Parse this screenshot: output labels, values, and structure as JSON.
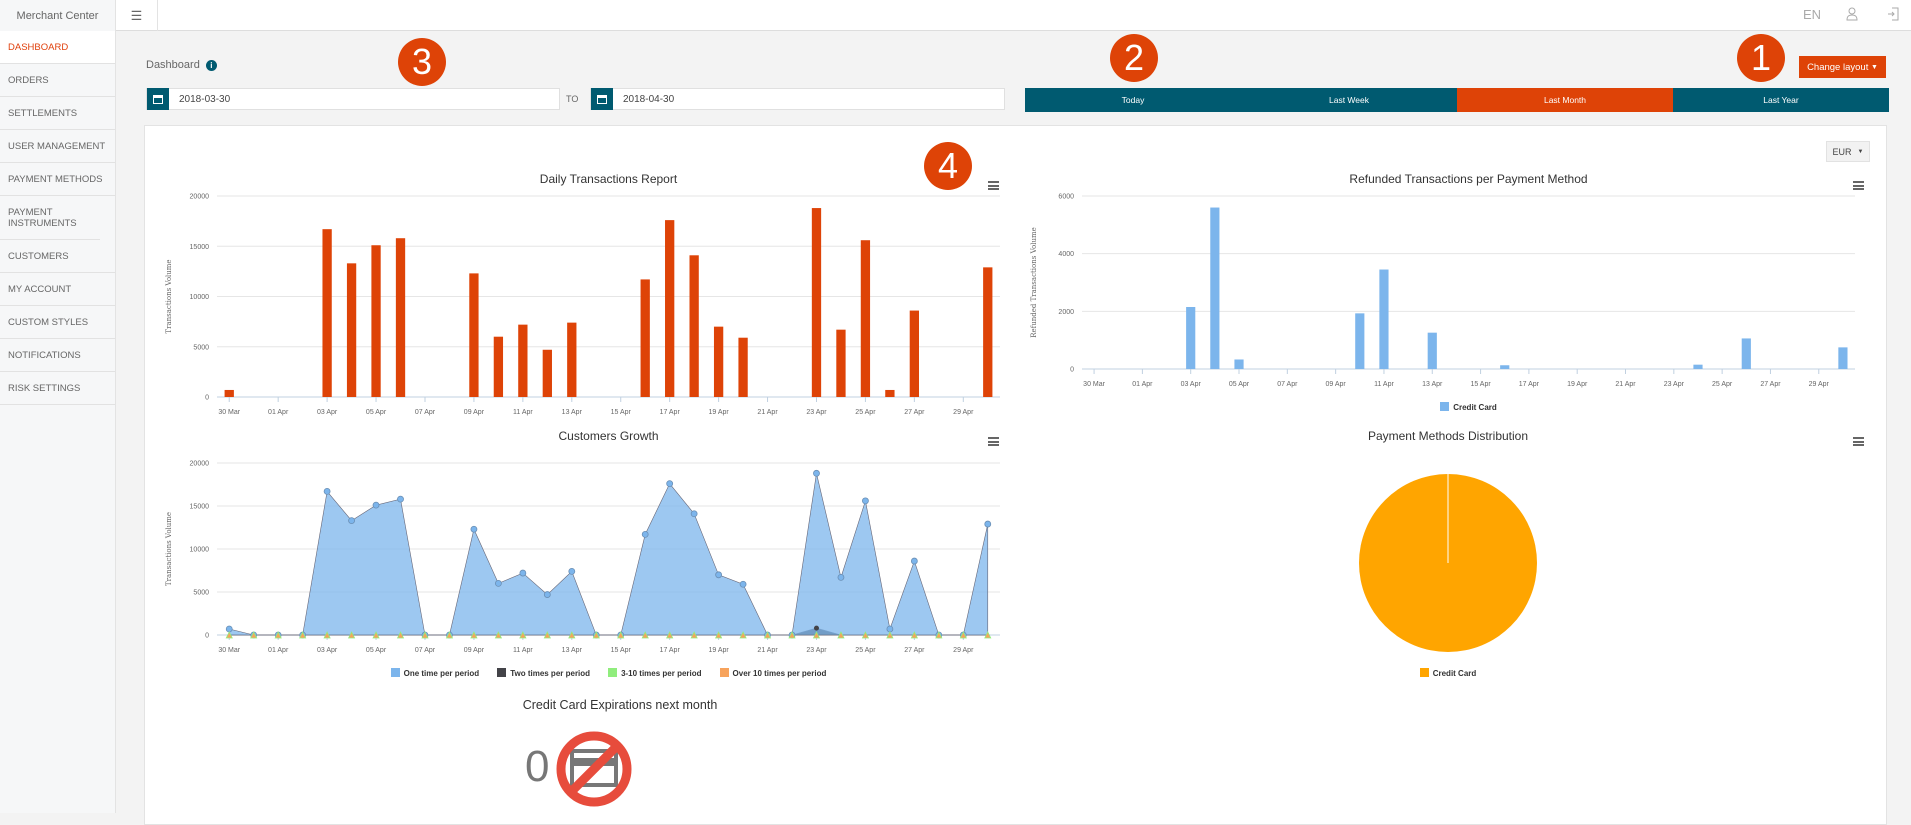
{
  "brand": "Merchant Center",
  "topbar": {
    "language": "EN",
    "icons": [
      "menu-icon",
      "user-icon",
      "logout-icon"
    ]
  },
  "sidebar": {
    "items": [
      {
        "label": "DASHBOARD",
        "active": true
      },
      {
        "label": "ORDERS"
      },
      {
        "label": "SETTLEMENTS"
      },
      {
        "label": "USER MANAGEMENT"
      },
      {
        "label": "PAYMENT METHODS"
      },
      {
        "label": "PAYMENT INSTRUMENTS"
      },
      {
        "label": "CUSTOMERS"
      },
      {
        "label": "MY ACCOUNT"
      },
      {
        "label": "CUSTOM STYLES"
      },
      {
        "label": "NOTIFICATIONS"
      },
      {
        "label": "RISK SETTINGS"
      }
    ]
  },
  "header": {
    "title": "Dashboard",
    "info_icon": "i",
    "date_from": "2018-03-30",
    "to_label": "TO",
    "date_to": "2018-04-30",
    "periods": [
      "Today",
      "Last Week",
      "Last Month",
      "Last Year"
    ],
    "selected_period": "Last Month",
    "change_layout": "Change layout"
  },
  "annotations": [
    "1",
    "2",
    "3",
    "4"
  ],
  "currency": "EUR",
  "colors": {
    "accent": "#de4307",
    "primary": "#005a70",
    "blue": "#7cb5ec",
    "pie": "#ffa500"
  },
  "chart_data": [
    {
      "id": "daily",
      "type": "bar",
      "title": "Daily Transactions Report",
      "ylabel": "Transactions Volume",
      "ylim": [
        0,
        20000
      ],
      "yticks": [
        0,
        5000,
        10000,
        15000,
        20000
      ],
      "grid": true,
      "categories": [
        "30 Mar",
        "31 Mar",
        "01 Apr",
        "02 Apr",
        "03 Apr",
        "04 Apr",
        "05 Apr",
        "06 Apr",
        "07 Apr",
        "08 Apr",
        "09 Apr",
        "10 Apr",
        "11 Apr",
        "12 Apr",
        "13 Apr",
        "14 Apr",
        "15 Apr",
        "16 Apr",
        "17 Apr",
        "18 Apr",
        "19 Apr",
        "20 Apr",
        "21 Apr",
        "22 Apr",
        "23 Apr",
        "24 Apr",
        "25 Apr",
        "26 Apr",
        "27 Apr",
        "28 Apr",
        "29 Apr",
        "30 Apr"
      ],
      "series": [
        {
          "values": [
            700,
            0,
            0,
            0,
            16700,
            13300,
            15100,
            15800,
            0,
            0,
            12300,
            6000,
            7200,
            4700,
            7400,
            0,
            0,
            11700,
            17600,
            14100,
            7000,
            5900,
            0,
            0,
            18800,
            6700,
            15600,
            700,
            8600,
            0,
            0,
            12900
          ],
          "color": "#de4307"
        }
      ]
    },
    {
      "id": "refunded",
      "type": "bar",
      "title": "Refunded Transactions per Payment Method",
      "ylabel": "Refunded Transactions Volume",
      "ylim": [
        0,
        6000
      ],
      "yticks": [
        0,
        2000,
        4000,
        6000
      ],
      "grid": true,
      "legend": "bottom",
      "categories": [
        "30 Mar",
        "31 Mar",
        "01 Apr",
        "02 Apr",
        "03 Apr",
        "04 Apr",
        "05 Apr",
        "06 Apr",
        "07 Apr",
        "08 Apr",
        "09 Apr",
        "10 Apr",
        "11 Apr",
        "12 Apr",
        "13 Apr",
        "14 Apr",
        "15 Apr",
        "16 Apr",
        "17 Apr",
        "18 Apr",
        "19 Apr",
        "20 Apr",
        "21 Apr",
        "22 Apr",
        "23 Apr",
        "24 Apr",
        "25 Apr",
        "26 Apr",
        "27 Apr",
        "28 Apr",
        "29 Apr",
        "30 Apr"
      ],
      "series": [
        {
          "name": "Credit Card",
          "values": [
            0,
            0,
            0,
            0,
            2150,
            5600,
            330,
            0,
            0,
            0,
            0,
            1930,
            3450,
            0,
            1260,
            0,
            0,
            130,
            0,
            0,
            0,
            0,
            0,
            0,
            0,
            150,
            0,
            1060,
            0,
            0,
            0,
            750
          ],
          "color": "#7cb5ec"
        }
      ]
    },
    {
      "id": "growth",
      "type": "area",
      "title": "Customers Growth",
      "ylabel": "Transactions Volume",
      "ylim": [
        0,
        20000
      ],
      "yticks": [
        0,
        5000,
        10000,
        15000,
        20000
      ],
      "grid": true,
      "legend": "bottom",
      "categories": [
        "30 Mar",
        "31 Mar",
        "01 Apr",
        "02 Apr",
        "03 Apr",
        "04 Apr",
        "05 Apr",
        "06 Apr",
        "07 Apr",
        "08 Apr",
        "09 Apr",
        "10 Apr",
        "11 Apr",
        "12 Apr",
        "13 Apr",
        "14 Apr",
        "15 Apr",
        "16 Apr",
        "17 Apr",
        "18 Apr",
        "19 Apr",
        "20 Apr",
        "21 Apr",
        "22 Apr",
        "23 Apr",
        "24 Apr",
        "25 Apr",
        "26 Apr",
        "27 Apr",
        "28 Apr",
        "29 Apr",
        "30 Apr"
      ],
      "series": [
        {
          "name": "One time per period",
          "color": "#7cb5ec",
          "values": [
            700,
            0,
            0,
            0,
            16700,
            13300,
            15100,
            15800,
            0,
            0,
            12300,
            6000,
            7200,
            4700,
            7400,
            0,
            0,
            11700,
            17600,
            14100,
            7000,
            5900,
            0,
            0,
            18800,
            6700,
            15600,
            700,
            8600,
            0,
            0,
            12900
          ]
        },
        {
          "name": "Two times per period",
          "color": "#434348",
          "values": [
            0,
            0,
            0,
            0,
            0,
            0,
            0,
            0,
            0,
            0,
            0,
            0,
            0,
            0,
            0,
            0,
            0,
            0,
            0,
            0,
            0,
            0,
            0,
            0,
            800,
            0,
            0,
            0,
            0,
            0,
            0,
            0
          ]
        },
        {
          "name": "3-10 times per period",
          "color": "#90ed7d",
          "values": [
            0,
            0,
            0,
            0,
            0,
            0,
            0,
            0,
            0,
            0,
            0,
            0,
            0,
            0,
            0,
            0,
            0,
            0,
            0,
            0,
            0,
            0,
            0,
            0,
            0,
            0,
            0,
            0,
            0,
            0,
            0,
            0
          ]
        },
        {
          "name": "Over 10 times per period",
          "color": "#f7a35c",
          "values": [
            0,
            0,
            0,
            0,
            0,
            0,
            0,
            0,
            0,
            0,
            0,
            0,
            0,
            0,
            0,
            0,
            0,
            0,
            0,
            0,
            0,
            0,
            0,
            0,
            0,
            0,
            0,
            0,
            0,
            0,
            0,
            0
          ]
        }
      ]
    },
    {
      "id": "distribution",
      "type": "pie",
      "title": "Payment Methods Distribution",
      "legend": "bottom",
      "slices": [
        {
          "name": "Credit Card",
          "value": 100,
          "color": "#ffa500"
        }
      ]
    }
  ],
  "cc_expirations": {
    "title": "Credit Card Expirations next month",
    "count": "0",
    "icon": "no-credit-card-icon"
  }
}
